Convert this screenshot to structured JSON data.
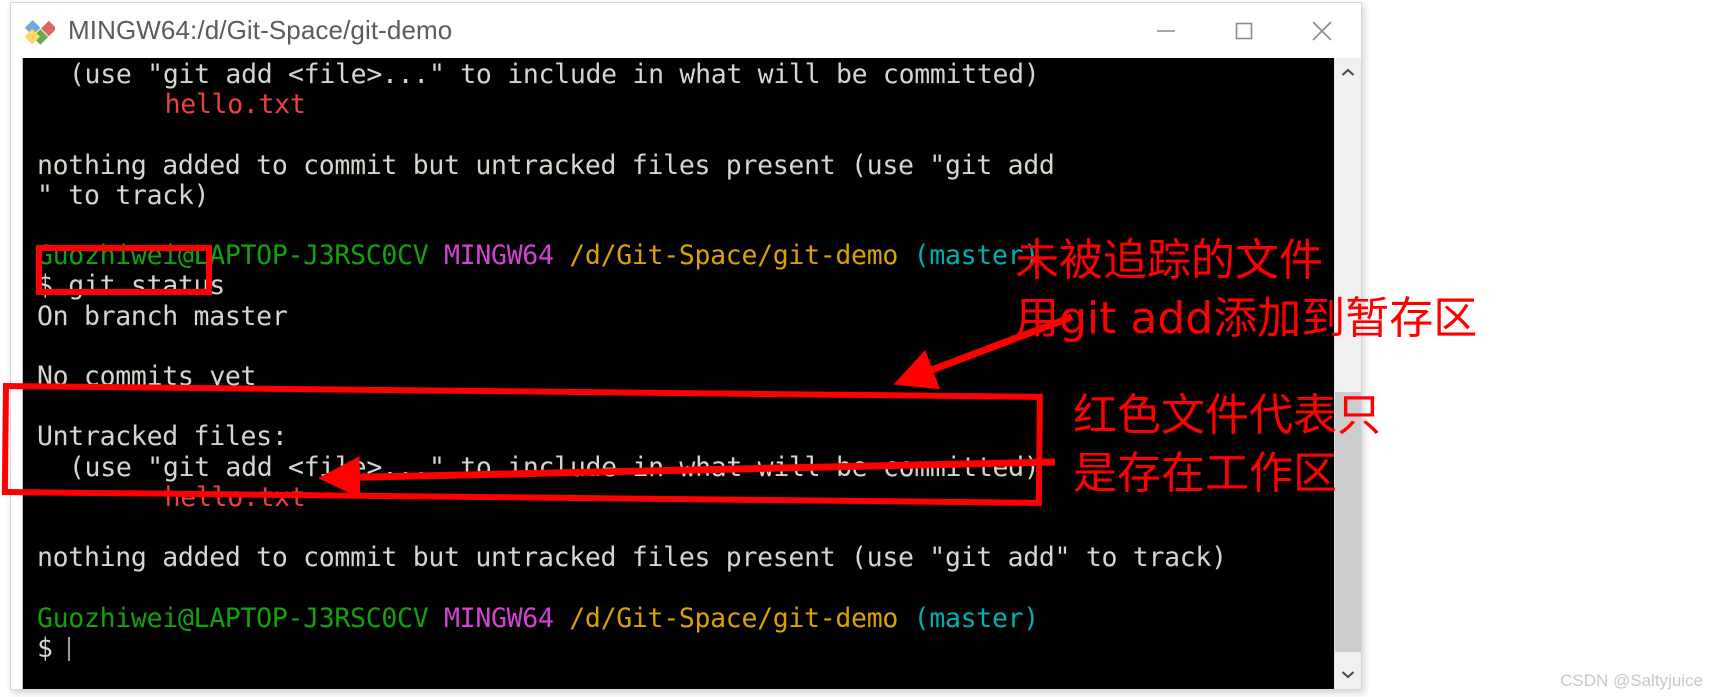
{
  "window": {
    "title": "MINGW64:/d/Git-Space/git-demo",
    "icon": "git-bash-icon",
    "controls": {
      "minimize": "minimize-button",
      "maximize": "maximize-button",
      "close": "close-button"
    }
  },
  "terminal": {
    "lines": [
      {
        "id": "l1",
        "indent": 2,
        "segments": [
          {
            "text": "(use \"git add <file>...\" to include in what will be committed)",
            "color": "white"
          }
        ]
      },
      {
        "id": "l2",
        "indent": 8,
        "segments": [
          {
            "text": "hello.txt",
            "color": "red"
          }
        ]
      },
      {
        "id": "l3",
        "indent": 0,
        "segments": [
          {
            "text": "",
            "color": "white"
          }
        ]
      },
      {
        "id": "l4",
        "indent": 0,
        "segments": [
          {
            "text": "nothing added to commit but untracked files present (use \"git add",
            "color": "white"
          }
        ]
      },
      {
        "id": "l5",
        "indent": 0,
        "segments": [
          {
            "text": "\" to track)",
            "color": "white"
          }
        ]
      },
      {
        "id": "l6",
        "indent": 0,
        "segments": [
          {
            "text": "",
            "color": "white"
          }
        ]
      },
      {
        "id": "l7",
        "indent": 0,
        "segments": [
          {
            "text": "Guozhiwei@LAPTOP-J3RSC0CV",
            "color": "green"
          },
          {
            "text": " ",
            "color": "white"
          },
          {
            "text": "MINGW64",
            "color": "magenta"
          },
          {
            "text": " ",
            "color": "white"
          },
          {
            "text": "/d/Git-Space/git-demo",
            "color": "yellow"
          },
          {
            "text": " ",
            "color": "white"
          },
          {
            "text": "(master)",
            "color": "cyan"
          }
        ]
      },
      {
        "id": "l8",
        "indent": 0,
        "segments": [
          {
            "text": "$ git status",
            "color": "white"
          }
        ]
      },
      {
        "id": "l9",
        "indent": 0,
        "segments": [
          {
            "text": "On branch master",
            "color": "white"
          }
        ]
      },
      {
        "id": "l10",
        "indent": 0,
        "segments": [
          {
            "text": "",
            "color": "white"
          }
        ]
      },
      {
        "id": "l11",
        "indent": 0,
        "segments": [
          {
            "text": "No commits yet",
            "color": "white"
          }
        ]
      },
      {
        "id": "l12",
        "indent": 0,
        "segments": [
          {
            "text": "",
            "color": "white"
          }
        ]
      },
      {
        "id": "l13",
        "indent": 0,
        "segments": [
          {
            "text": "Untracked files:",
            "color": "white"
          }
        ]
      },
      {
        "id": "l14",
        "indent": 2,
        "segments": [
          {
            "text": "(use \"git add <file>...\" to include in what will be committed)",
            "color": "white"
          }
        ]
      },
      {
        "id": "l15",
        "indent": 8,
        "segments": [
          {
            "text": "hello.txt",
            "color": "red"
          }
        ]
      },
      {
        "id": "l16",
        "indent": 0,
        "segments": [
          {
            "text": "",
            "color": "white"
          }
        ]
      },
      {
        "id": "l17",
        "indent": 0,
        "segments": [
          {
            "text": "nothing added to commit but untracked files present (use \"git add\" to track)",
            "color": "white"
          }
        ]
      },
      {
        "id": "l18",
        "indent": 0,
        "segments": [
          {
            "text": "",
            "color": "white"
          }
        ]
      },
      {
        "id": "l19",
        "indent": 0,
        "segments": [
          {
            "text": "Guozhiwei@LAPTOP-J3RSC0CV",
            "color": "green"
          },
          {
            "text": " ",
            "color": "white"
          },
          {
            "text": "MINGW64",
            "color": "magenta"
          },
          {
            "text": " ",
            "color": "white"
          },
          {
            "text": "/d/Git-Space/git-demo",
            "color": "yellow"
          },
          {
            "text": " ",
            "color": "white"
          },
          {
            "text": "(master)",
            "color": "cyan"
          }
        ]
      },
      {
        "id": "l20",
        "indent": 0,
        "segments": [
          {
            "text": "$ ",
            "color": "white"
          }
        ]
      }
    ],
    "prompt_symbol": "$",
    "command": "git status",
    "colors": {
      "background": "#000000",
      "foreground": "#d3d7cf",
      "red": "#ef4040",
      "green": "#13a10e",
      "magenta": "#d442d4",
      "yellow": "#d8a200",
      "cyan": "#00b0b0"
    }
  },
  "scrollbar": {
    "up_arrow": "chevron-up-icon",
    "down_arrow": "chevron-down-icon"
  },
  "annotations": {
    "color": "#ff0000",
    "texts": [
      {
        "id": "a1",
        "text": "未被追踪的文件"
      },
      {
        "id": "a2",
        "text": "用git add添加到暂存区"
      },
      {
        "id": "a3",
        "text": "红色文件代表只"
      },
      {
        "id": "a4",
        "text": "是存在工作区"
      }
    ],
    "boxes": [
      {
        "id": "b1",
        "target": "git status"
      },
      {
        "id": "b2",
        "target": "Untracked files block"
      }
    ],
    "arrows": [
      {
        "id": "ar1",
        "direction": "down-left",
        "points_to": "(master) prompt line"
      },
      {
        "id": "ar2",
        "direction": "left",
        "points_to": "hello.txt"
      }
    ]
  },
  "watermark": {
    "text": "CSDN @Saltyjuice"
  }
}
